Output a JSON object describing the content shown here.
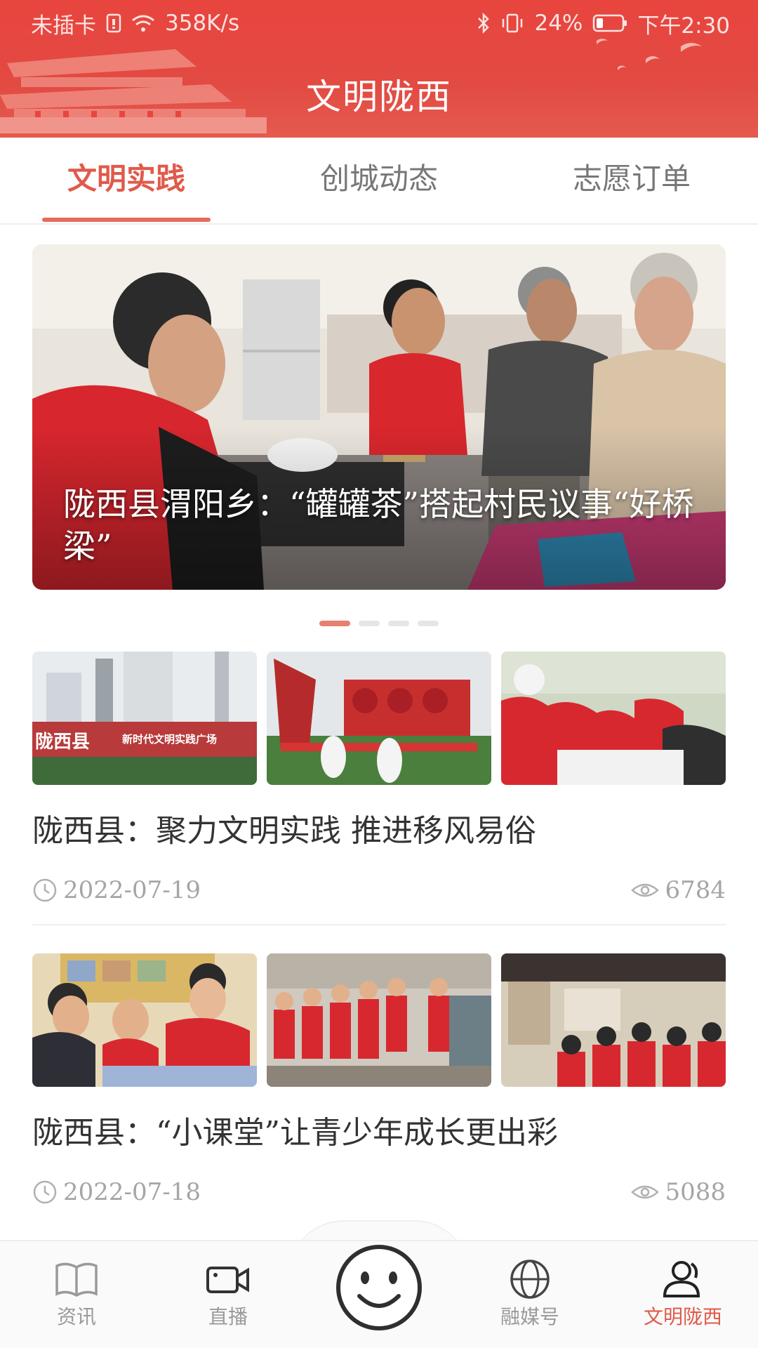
{
  "status_bar": {
    "carrier": "未插卡",
    "speed": "358K/s",
    "battery": "24%",
    "time": "下午2:30"
  },
  "header": {
    "title": "文明陇西"
  },
  "tabs": [
    {
      "label": "文明实践",
      "active": true
    },
    {
      "label": "创城动态",
      "active": false
    },
    {
      "label": "志愿订单",
      "active": false
    }
  ],
  "banner": {
    "caption": "陇西县渭阳乡：“罐罐茶”搭起村民议事“好桥梁”",
    "page_index": 0,
    "page_count": 4
  },
  "news": [
    {
      "title": "陇西县：聚力文明实践 推进移风易俗",
      "date": "2022-07-19",
      "views": "6784",
      "thumb_texts": [
        "陇西县",
        "新时代文明实践广场"
      ]
    },
    {
      "title": "陇西县：“小课堂”让青少年成长更出彩",
      "date": "2022-07-18",
      "views": "5088",
      "thumb_texts": []
    }
  ],
  "bottom_nav": [
    {
      "label": "资讯",
      "icon": "book-icon",
      "active": false
    },
    {
      "label": "直播",
      "icon": "video-camera-icon",
      "active": false
    },
    {
      "label": "",
      "icon": "smiley-icon",
      "active": false
    },
    {
      "label": "融媒号",
      "icon": "globe-icon",
      "active": false
    },
    {
      "label": "文明陇西",
      "icon": "user-icon",
      "active": true
    }
  ],
  "colors": {
    "header_red": "#e8453e",
    "accent": "#e05a4b",
    "muted": "#a5a5a5"
  }
}
